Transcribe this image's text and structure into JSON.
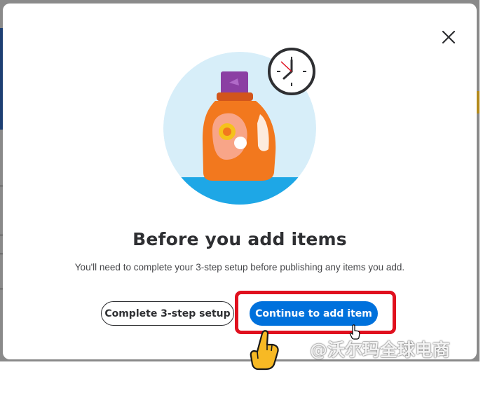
{
  "modal": {
    "title": "Before you add items",
    "description": "You'll need to complete your 3-step setup before publishing any items you add.",
    "close_icon": "close-icon"
  },
  "buttons": {
    "secondary_label": "Complete 3-step setup",
    "primary_label": "Continue to add item"
  },
  "illustration": {
    "name": "detergent-bottle-with-clock",
    "icons": [
      "clock-icon",
      "detergent-bottle"
    ]
  },
  "annotations": {
    "watermark": "@沃尔玛全球电商",
    "highlight": "red-highlight-box",
    "pointer_icon": "hand-pointer-icon"
  },
  "colors": {
    "primary": "#0071dc",
    "highlight": "#e0101e",
    "bottle": "#f2781e",
    "cap": "#8b3fa3",
    "circle_bg": "#d7eef9",
    "water": "#1ea7e6"
  }
}
